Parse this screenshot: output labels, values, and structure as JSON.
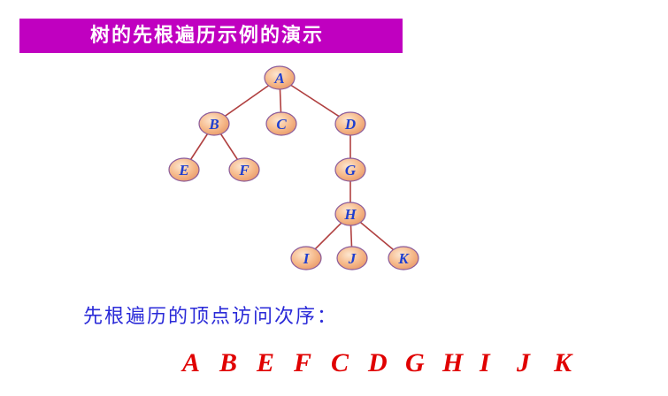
{
  "title": "树的先根遍历示例的演示",
  "tree": {
    "nodes": [
      {
        "id": "A",
        "label": "A"
      },
      {
        "id": "B",
        "label": "B"
      },
      {
        "id": "C",
        "label": "C"
      },
      {
        "id": "D",
        "label": "D"
      },
      {
        "id": "E",
        "label": "E"
      },
      {
        "id": "F",
        "label": "F"
      },
      {
        "id": "G",
        "label": "G"
      },
      {
        "id": "H",
        "label": "H"
      },
      {
        "id": "I",
        "label": "I"
      },
      {
        "id": "J",
        "label": "J"
      },
      {
        "id": "K",
        "label": "K"
      }
    ],
    "edges": [
      [
        "A",
        "B"
      ],
      [
        "A",
        "C"
      ],
      [
        "A",
        "D"
      ],
      [
        "B",
        "E"
      ],
      [
        "B",
        "F"
      ],
      [
        "D",
        "G"
      ],
      [
        "G",
        "H"
      ],
      [
        "H",
        "I"
      ],
      [
        "H",
        "J"
      ],
      [
        "H",
        "K"
      ]
    ]
  },
  "caption": "先根遍历的顶点访问次序：",
  "sequence": [
    "A",
    "B",
    "E",
    "F",
    "C",
    "D",
    "G",
    "H",
    "I",
    "J",
    "K"
  ],
  "colors": {
    "title_bg": "#c000c0",
    "node_fill": "#f6b98a",
    "node_stroke": "#8a5a9a",
    "node_text": "#1f3fd0",
    "edge": "#b04040",
    "caption": "#2a2ad8",
    "sequence": "#e00000"
  }
}
